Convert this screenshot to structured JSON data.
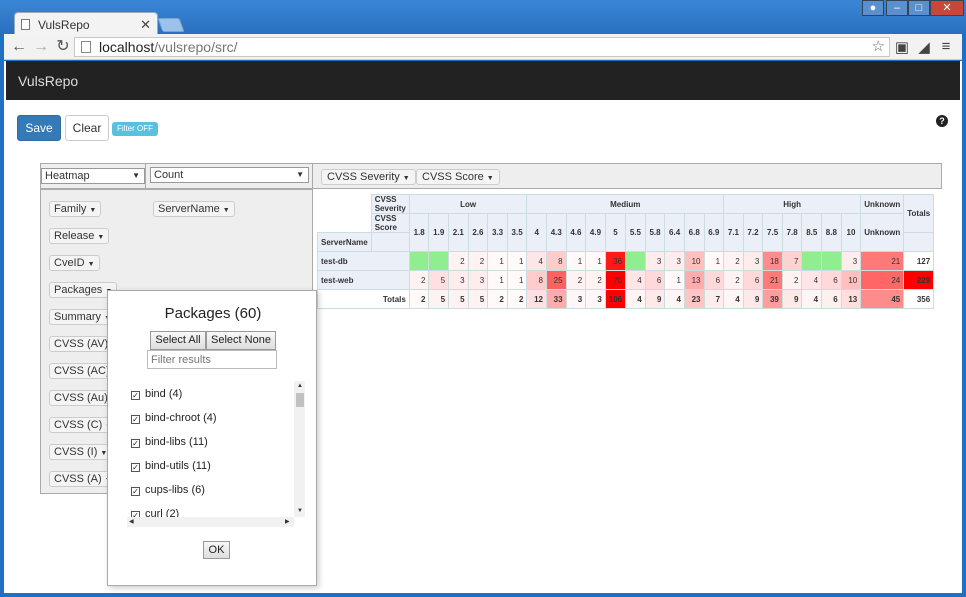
{
  "browser": {
    "tab_title": "VulsRepo",
    "url_host": "localhost",
    "url_path": "/vulsrepo/src/"
  },
  "app": {
    "title": "VulsRepo",
    "save_label": "Save",
    "clear_label": "Clear",
    "filter_badge": "Filter OFF",
    "help_glyph": "?"
  },
  "pivot": {
    "renderer": "Heatmap",
    "aggregator": "Count",
    "col_attrs": [
      "CVSS Severity",
      "CVSS Score"
    ],
    "row_attr": "ServerName",
    "unused_attrs": [
      "Family",
      "Release",
      "CveID",
      "Packages",
      "Summary",
      "CVSS (AV)",
      "CVSS (AC)",
      "CVSS (Au)",
      "CVSS (C)",
      "CVSS (I)",
      "CVSS (A)"
    ],
    "table": {
      "severity_header": "CVSS Severity",
      "score_header": "CVSS Score",
      "row_header": "ServerName",
      "groups": [
        {
          "label": "Low",
          "span": 6
        },
        {
          "label": "Medium",
          "span": 10
        },
        {
          "label": "High",
          "span": 7
        },
        {
          "label": "Unknown",
          "span": 1
        }
      ],
      "totals_label": "Totals",
      "scores": [
        "1.8",
        "1.9",
        "2.1",
        "2.6",
        "3.3",
        "3.5",
        "4",
        "4.3",
        "4.6",
        "4.9",
        "5",
        "5.5",
        "5.8",
        "6.4",
        "6.8",
        "6.9",
        "7.1",
        "7.2",
        "7.5",
        "7.8",
        "8.5",
        "8.8",
        "10",
        "Unknown"
      ],
      "rows": [
        {
          "name": "test-db",
          "cells": [
            "",
            "",
            "2",
            "2",
            "1",
            "1",
            "4",
            "8",
            "1",
            "1",
            "36",
            "",
            "3",
            "3",
            "10",
            "1",
            "2",
            "3",
            "18",
            "7",
            "",
            "",
            "3",
            "21"
          ],
          "total": "127"
        },
        {
          "name": "test-web",
          "cells": [
            "2",
            "5",
            "3",
            "3",
            "1",
            "1",
            "8",
            "25",
            "2",
            "2",
            "70",
            "4",
            "6",
            "1",
            "13",
            "6",
            "2",
            "6",
            "21",
            "2",
            "4",
            "6",
            "10",
            "24"
          ],
          "total": "229"
        }
      ],
      "col_totals": [
        "2",
        "5",
        "5",
        "5",
        "2",
        "2",
        "12",
        "33",
        "3",
        "3",
        "106",
        "4",
        "9",
        "4",
        "23",
        "7",
        "4",
        "9",
        "39",
        "9",
        "4",
        "6",
        "13",
        "45"
      ],
      "grand_total": "356"
    }
  },
  "popup": {
    "title": "Packages (60)",
    "select_all": "Select All",
    "select_none": "Select None",
    "filter_placeholder": "Filter results",
    "ok_label": "OK",
    "items": [
      "bind (4)",
      "bind-chroot (4)",
      "bind-libs (11)",
      "bind-utils (11)",
      "cups-libs (6)",
      "curl (2)"
    ]
  },
  "colors": {
    "hm_green": "#90ee90",
    "hm_red": "#ff0000",
    "primary": "#337ab7",
    "info": "#5bc0de",
    "navbar": "#222222"
  }
}
